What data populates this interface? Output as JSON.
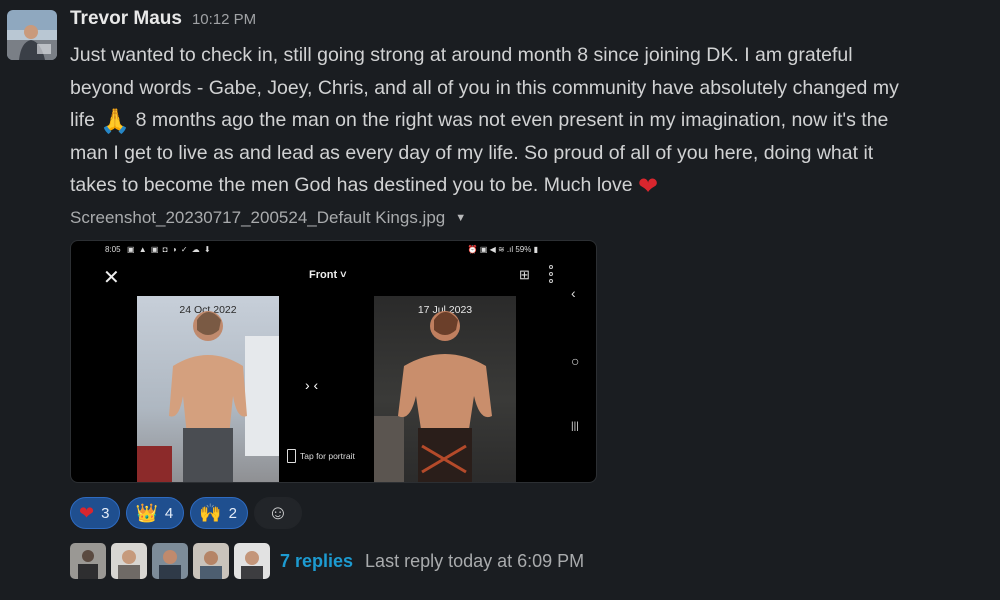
{
  "message": {
    "author": "Trevor Maus",
    "time": "10:12 PM",
    "lines": [
      "Just wanted to check in, still going strong at around month 8 since joining DK. I am grateful",
      "beyond words - Gabe, Joey, Chris, and all of you in this community have absolutely changed my"
    ],
    "line3_a": "life",
    "pray_emoji": "🙏",
    "line3_b": "8 months ago the man on the right was not even present in my imagination, now it's the",
    "line4": "man I get to live as and lead as every day of my life. So proud of all of you here, doing what it",
    "line5": "takes to become the men God has destined you to be. Much love",
    "heart_emoji": "❤"
  },
  "attachment": {
    "filename": "Screenshot_20230717_200524_Default Kings.jpg",
    "caret": "▼",
    "status_time": "8:05",
    "status_icons": "▣ ▲ ▣ ◘ ◑ ✓ ☁ ⬇",
    "status_right": "⏰ ▣ ◀ ≋ .ıl 59% ▮",
    "close": "✕",
    "view_label": "Front ˅",
    "compare_icon": "⊞",
    "nav_back": "‹",
    "nav_home": "○",
    "nav_recent": "|||",
    "left_date": "24 Oct 2022",
    "right_date": "17 Jul 2023",
    "arrows": "›   ‹",
    "portrait_hint": "Tap for portrait"
  },
  "reactions": [
    {
      "emoji": "❤",
      "count": "3",
      "color": "#d9262e"
    },
    {
      "emoji": "👑",
      "count": "4",
      "color": "#f5b81c"
    },
    {
      "emoji": "🙌",
      "count": "2",
      "color": "#f5b81c"
    }
  ],
  "add_reaction_icon": "☺",
  "thread": {
    "replies": "7 replies",
    "last_reply": "Last reply today at 6:09 PM"
  },
  "colors": {
    "background": "#1a1d21",
    "link": "#1d9bd1",
    "reaction_bg": "#1f4f8f"
  }
}
